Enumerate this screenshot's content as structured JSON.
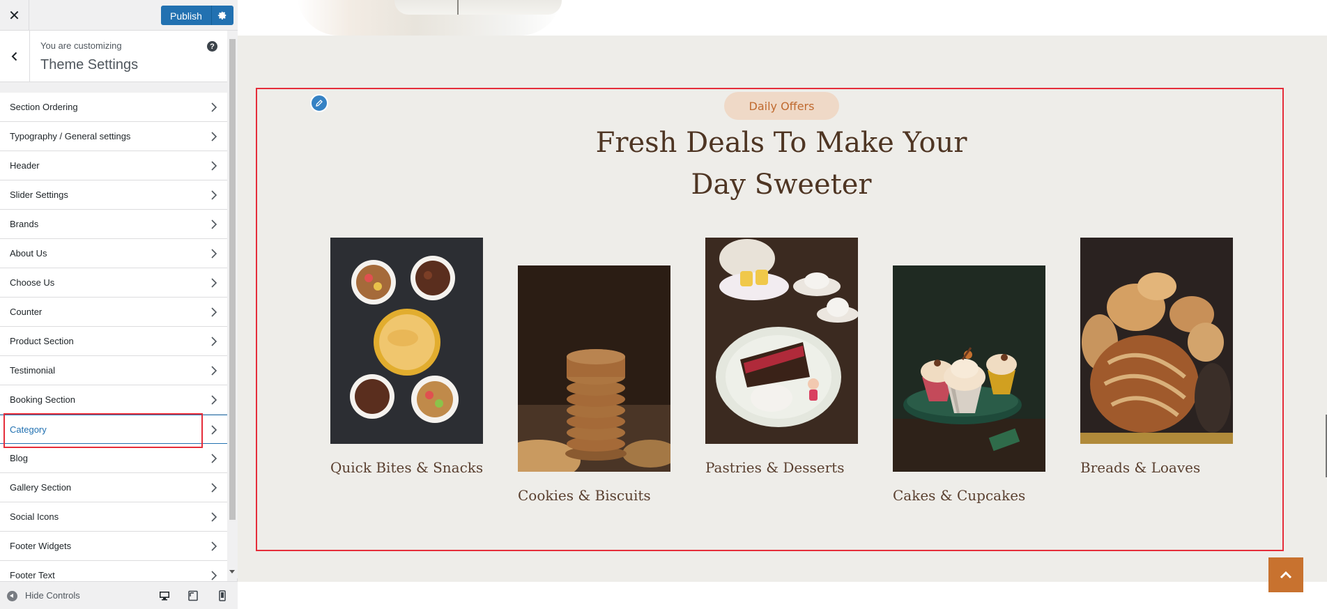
{
  "topbar": {
    "publish_label": "Publish"
  },
  "panel": {
    "subtitle": "You are customizing",
    "title": "Theme Settings"
  },
  "menu": {
    "items": [
      "Section Ordering",
      "Typography / General settings",
      "Header",
      "Slider Settings",
      "Brands",
      "About Us",
      "Choose Us",
      "Counter",
      "Product Section",
      "Testimonial",
      "Booking Section",
      "Category",
      "Blog",
      "Gallery Section",
      "Social Icons",
      "Footer Widgets",
      "Footer Text"
    ],
    "active": "Category"
  },
  "footer": {
    "hide_label": "Hide Controls"
  },
  "preview": {
    "badge": "Daily Offers",
    "heading_line1": "Fresh Deals To Make Your",
    "heading_line2": "Day Sweeter",
    "categories": [
      "Quick Bites & Snacks",
      "Cookies & Biscuits",
      "Pastries & Desserts",
      "Cakes & Cupcakes",
      "Breads & Loaves"
    ]
  },
  "colors": {
    "wp_blue": "#2271b1",
    "highlight_red": "#e52d3a",
    "section_bg": "#eeede9",
    "heading_brown": "#4e3523",
    "badge_bg": "#efd9c7",
    "badge_text": "#c06a2f",
    "accent_orange": "#c8722f"
  }
}
